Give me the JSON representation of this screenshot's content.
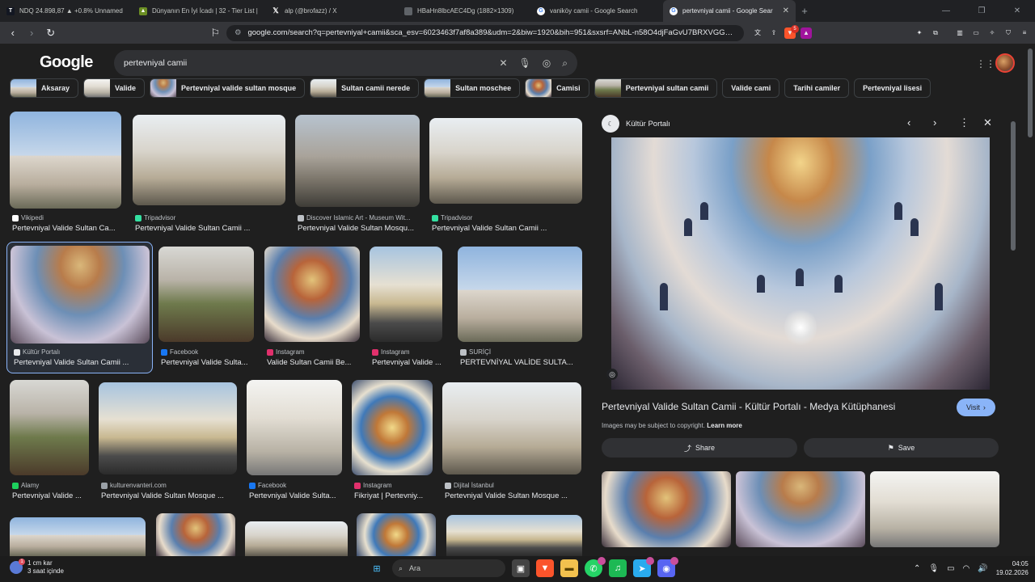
{
  "browser": {
    "tabs": [
      {
        "label": "NDQ 24.898,87 ▲ +0.8% Unnamed",
        "icon": "tradingview-icon",
        "active": false
      },
      {
        "label": "Dünyanın En İyi İcadı | 32 - Tier List |",
        "icon": "tierlist-icon",
        "active": false
      },
      {
        "label": "alp (@brofazz) / X",
        "icon": "x-icon",
        "active": false
      },
      {
        "label": "HBaHn8lbcAEC4Dg (1882×1309)",
        "icon": "image-icon",
        "active": false
      },
      {
        "label": "vaniköy camii - Google Search",
        "icon": "google-icon",
        "active": false
      },
      {
        "label": "pertevniyal camii - Google Sear",
        "icon": "google-icon",
        "active": true
      }
    ],
    "new_tab": "+",
    "url": "google.com/search?q=pertevniyal+camii&sca_esv=6023463f7af8a389&udm=2&biw=1920&bih=951&sxsrf=ANbL-n58O4djFaGvU7BRXVGGNg...",
    "ext_badge": "5"
  },
  "google": {
    "logo": "Google",
    "query": "pertevniyal camii",
    "chips": [
      {
        "label": "Aksaray",
        "thumb": true
      },
      {
        "label": "Valide",
        "thumb": true
      },
      {
        "label": "Pertevniyal valide sultan mosque",
        "thumb": true
      },
      {
        "label": "Sultan camii nerede",
        "thumb": true
      },
      {
        "label": "Sultan moschee",
        "thumb": true
      },
      {
        "label": "Camisi",
        "thumb": true
      },
      {
        "label": "Pertevniyal sultan camii",
        "thumb": true
      },
      {
        "label": "Valide cami",
        "thumb": false
      },
      {
        "label": "Tarihi camiler",
        "thumb": false
      },
      {
        "label": "Pertevniyal lisesi",
        "thumb": false
      }
    ],
    "results": [
      {
        "source": "Vikipedi",
        "title": "Pertevniyal Valide Sultan Ca..."
      },
      {
        "source": "Tripadvisor",
        "title": "Pertevniyal Valide Sultan Camii ..."
      },
      {
        "source": "Discover Islamic Art - Museum Wit...",
        "title": "Pertevniyal Valide Sultan Mosqu..."
      },
      {
        "source": "Tripadvisor",
        "title": "Pertevniyal Valide Sultan Camii ..."
      },
      {
        "source": "Kültür Portalı",
        "title": "Pertevniyal Valide Sultan Camii ..."
      },
      {
        "source": "Facebook",
        "title": "Pertevniyal Valide Sulta..."
      },
      {
        "source": "Instagram",
        "title": "Valide Sultan Camii Be..."
      },
      {
        "source": "Instagram",
        "title": "Pertevniyal Valide ..."
      },
      {
        "source": "SURİÇİ",
        "title": "PERTEVNİYAL VALİDE SULTA..."
      },
      {
        "source": "Alamy",
        "title": "Pertevniyal Valide ..."
      },
      {
        "source": "kulturenvanteri.com",
        "title": "Pertevniyal Valide Sultan Mosque ..."
      },
      {
        "source": "Facebook",
        "title": "Pertevniyal Valide Sulta..."
      },
      {
        "source": "Instagram",
        "title": "Fikriyat | Pertevniy..."
      },
      {
        "source": "Dijital İstanbul",
        "title": "Pertevniyal Valide Sultan Mosque ..."
      }
    ],
    "panel": {
      "source": "Kültür Portalı",
      "title": "Pertevniyal Valide Sultan Camii - Kültür Portalı - Medya Kütüphanesi",
      "visit": "Visit",
      "copyright": "Images may be subject to copyright.",
      "learn_more": "Learn more",
      "share": "Share",
      "save": "Save"
    }
  },
  "taskbar": {
    "weather_line1": "1 cm kar",
    "weather_line2": "3 saat içinde",
    "weather_badge": "1",
    "search_placeholder": "Ara",
    "time": "04:05",
    "date": "19.02.2026"
  }
}
